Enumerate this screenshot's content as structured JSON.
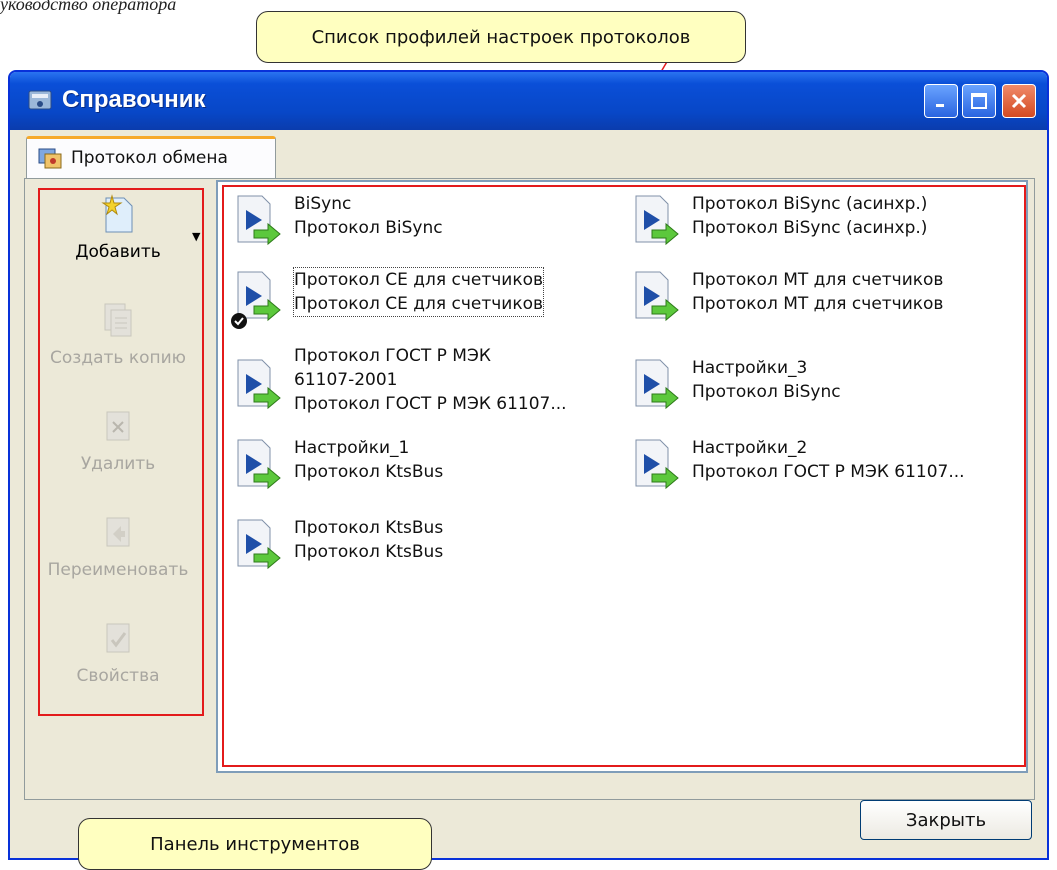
{
  "doc_header": "уководство оператора",
  "callouts": {
    "profiles_list": "Список профилей настроек протоколов",
    "toolbar": "Панель инструментов"
  },
  "window": {
    "title": "Справочник",
    "tab_label": "Протокол обмена",
    "close_button": "Закрыть"
  },
  "toolbar": {
    "add": "Добавить",
    "copy": "Создать копию",
    "delete": "Удалить",
    "rename": "Переименовать",
    "properties": "Свойства"
  },
  "profiles": [
    {
      "line1": "BiSync",
      "line2": "",
      "line3": "Протокол BiSync"
    },
    {
      "line1": "Протокол BiSync (асинхр.)",
      "line2": "",
      "line3": "Протокол BiSync (асинхр.)"
    },
    {
      "line1": "Протокол CE для счетчиков",
      "line2": "",
      "line3": "Протокол CE для счетчиков"
    },
    {
      "line1": "Протокол МТ для счетчиков",
      "line2": "",
      "line3": "Протокол МТ для счетчиков"
    },
    {
      "line1": "Протокол ГОСТ Р МЭК",
      "line2": "61107-2001",
      "line3": "Протокол ГОСТ Р МЭК 61107..."
    },
    {
      "line1": "Настройки_3",
      "line2": "",
      "line3": "Протокол BiSync"
    },
    {
      "line1": "Настройки_1",
      "line2": "",
      "line3": "Протокол KtsBus"
    },
    {
      "line1": "Настройки_2",
      "line2": "",
      "line3": "Протокол ГОСТ Р МЭК 61107..."
    },
    {
      "line1": "Протокол KtsBus",
      "line2": "",
      "line3": "Протокол KtsBus"
    }
  ]
}
